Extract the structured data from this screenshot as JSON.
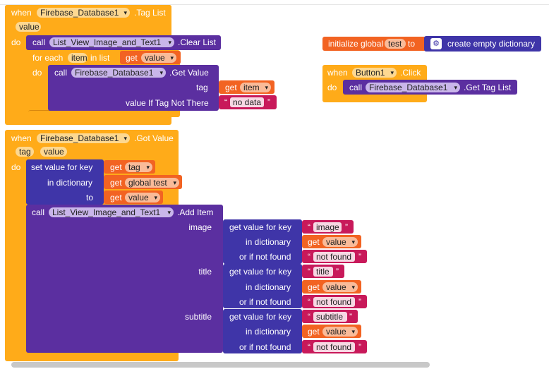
{
  "event1": {
    "when": "when",
    "component": "Firebase_Database1",
    "event": ".Tag List",
    "param": "value",
    "do": "do",
    "call": "call",
    "clear_component": "List_View_Image_and_Text1",
    "clear_method": ".Clear List",
    "foreach": "for each",
    "item": "item",
    "in_list": "in list",
    "get": "get",
    "get_value": "value",
    "do2": "do",
    "call2": "call",
    "getvalue_component": "Firebase_Database1",
    "getvalue_method": ".Get Value",
    "tag_label": "tag",
    "get_item": "item",
    "value_if_label": "value If Tag Not There",
    "no_data": "no data"
  },
  "init_global": {
    "label": "initialize global",
    "name": "test",
    "to": "to",
    "create_dict": "create empty dictionary"
  },
  "event_click": {
    "when": "when",
    "component": "Button1",
    "event": ".Click",
    "do": "do",
    "call": "call",
    "target_component": "Firebase_Database1",
    "target_method": ".Get Tag List"
  },
  "event2": {
    "when": "when",
    "component": "Firebase_Database1",
    "event": ".Got Value",
    "param_tag": "tag",
    "param_value": "value",
    "do": "do",
    "set_value": "set value for key",
    "get": "get",
    "get_tag": "tag",
    "in_dictionary": "in dictionary",
    "get_global": "global test",
    "to": "to",
    "get_value": "value",
    "call": "call",
    "add_component": "List_View_Image_and_Text1",
    "add_method": ".Add Item",
    "rows": [
      {
        "slot": "image",
        "key": "image",
        "dict_var": "value",
        "fallback": "not found"
      },
      {
        "slot": "title",
        "key": "title",
        "dict_var": "value",
        "fallback": "not found"
      },
      {
        "slot": "subtitle",
        "key": "subtitle",
        "dict_var": "value",
        "fallback": "not found"
      }
    ],
    "get_value_for_key": "get value for key",
    "in_dict_label": "in dictionary",
    "or_if_not_found": "or if not found"
  },
  "colors": {
    "event": "#ffab19",
    "component": "#5b2fa0",
    "variable": "#f26322",
    "text": "#c8195a",
    "dictionary": "#3f35a8"
  }
}
